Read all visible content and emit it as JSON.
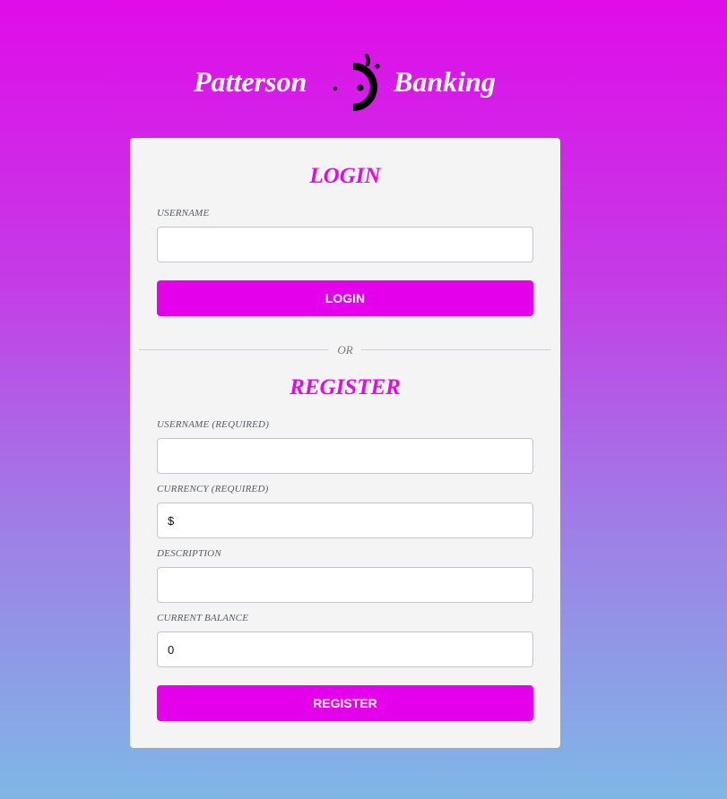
{
  "brand": {
    "left_text": "Patterson",
    "right_text": "Banking",
    "logo_icon": "crescent-face-logo-icon"
  },
  "login": {
    "title": "LOGIN",
    "username_label": "USERNAME",
    "username_value": "",
    "button_label": "LOGIN"
  },
  "divider": {
    "text": "OR"
  },
  "register": {
    "title": "REGISTER",
    "username_label": "USERNAME (REQUIRED)",
    "username_value": "",
    "currency_label": "CURRENCY (REQUIRED)",
    "currency_value": "$",
    "description_label": "DESCRIPTION",
    "description_value": "",
    "balance_label": "CURRENT BALANCE",
    "balance_value": "0",
    "button_label": "REGISTER"
  },
  "colors": {
    "accent": "#e400ea",
    "title": "#e20ae8",
    "card": "#f4f4f5",
    "gradient_top": "#e00ce9",
    "gradient_bottom": "#7fb7e6"
  }
}
